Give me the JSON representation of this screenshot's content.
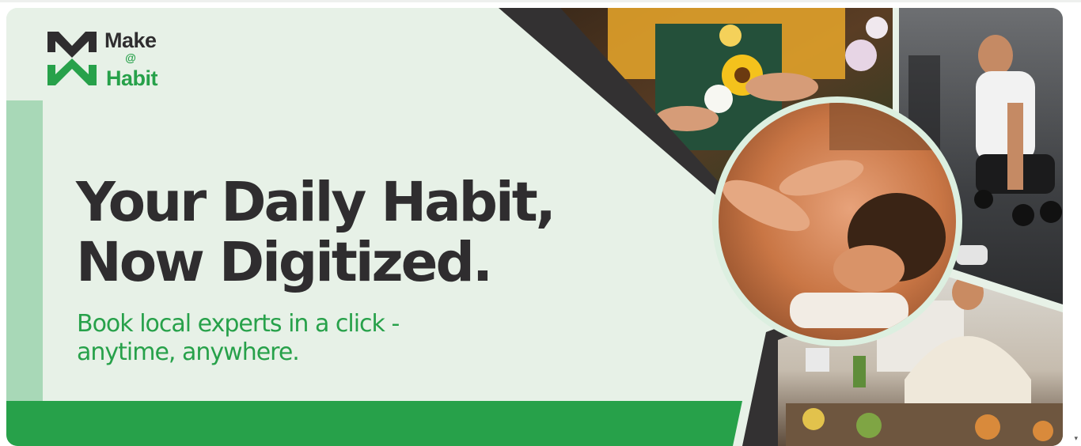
{
  "brand": {
    "logo_top": "Make",
    "logo_at": "@",
    "logo_bottom": "Habit"
  },
  "hero": {
    "headline_line1": "Your Daily Habit,",
    "headline_line2": "Now Digitized.",
    "subline_line1": "Book local experts in a click -",
    "subline_line2": "anytime, anywhere."
  },
  "photos": {
    "florist": "florist-arranging-flowers-photo",
    "massage": "massage-therapy-photo",
    "fitness": "gym-fitness-trainer-photo",
    "chef": "home-chef-cooking-photo"
  },
  "colors": {
    "brand_green": "#27a14a",
    "dark": "#2f2d2f",
    "background": "#e7f1e7"
  },
  "scrollbar": {
    "down_arrow_icon": "chevron-down-icon",
    "arrow_glyph": "▾"
  }
}
